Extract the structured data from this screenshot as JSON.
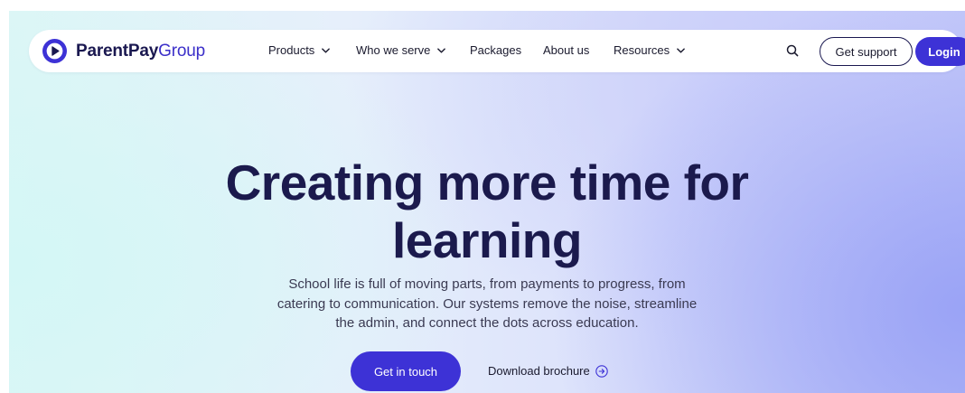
{
  "brand": {
    "name_bold": "ParentPay",
    "name_light": "Group",
    "primary_color": "#3d32d6",
    "dark_color": "#1a1850",
    "icon": "play-circle-logo-icon"
  },
  "nav": {
    "items": [
      {
        "label": "Products",
        "has_dropdown": true
      },
      {
        "label": "Who we serve",
        "has_dropdown": true
      },
      {
        "label": "Packages",
        "has_dropdown": false
      },
      {
        "label": "About us",
        "has_dropdown": false
      },
      {
        "label": "Resources",
        "has_dropdown": true
      }
    ],
    "search_icon": "search-icon",
    "support_label": "Get support",
    "login_label": "Login"
  },
  "hero": {
    "headline_line1": "Creating more time for",
    "headline_line2": "learning",
    "sub_line1": "School life is full of moving parts, from payments to progress, from",
    "sub_line2": "catering to communication. Our systems remove the noise, streamline",
    "sub_line3": "the admin, and connect the dots across education.",
    "cta_primary": "Get in touch",
    "cta_secondary": "Download brochure",
    "cta_secondary_icon": "arrow-right-circle-icon"
  }
}
